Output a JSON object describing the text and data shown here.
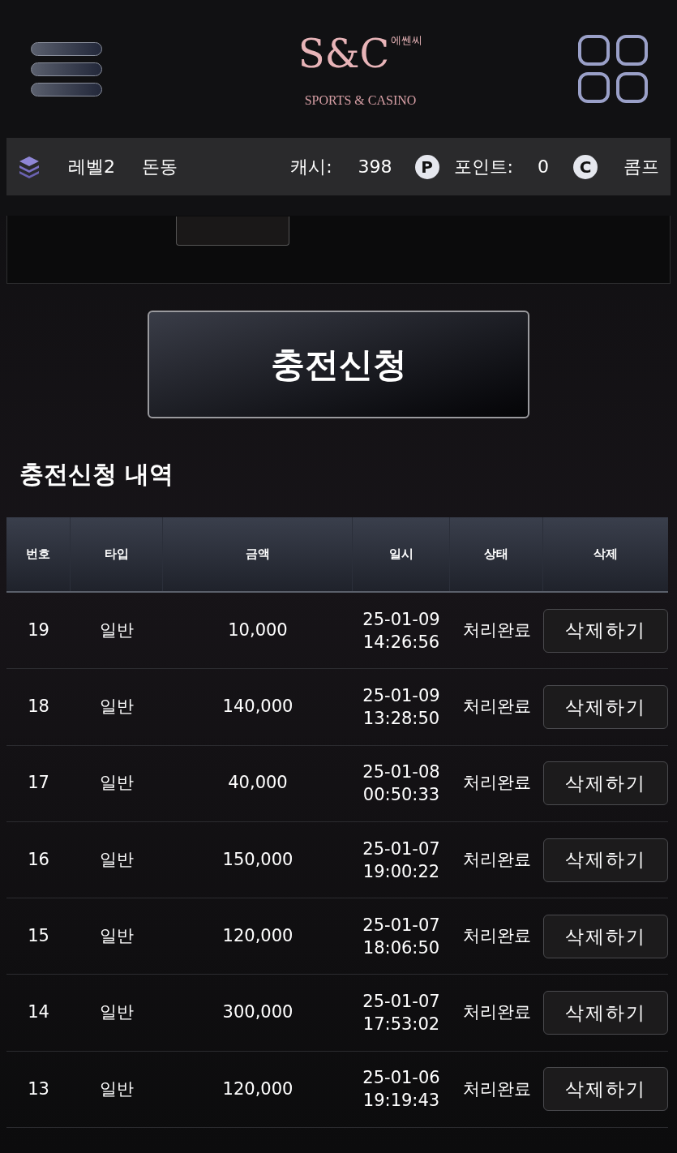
{
  "header": {
    "logo": {
      "mark": "S&C",
      "korean": "에쎈씨",
      "tagline": "SPORTS & CASINO"
    }
  },
  "user_bar": {
    "level": "레벨2",
    "name": "돈동",
    "cash_label": "캐시:",
    "cash": "398",
    "point_icon": "P",
    "point_label": "포인트:",
    "point": "0",
    "comp_icon": "C",
    "comp_label": "콤프"
  },
  "submit_button": "충전신청",
  "history": {
    "title": "충전신청 내역",
    "columns": [
      "번호",
      "타입",
      "금액",
      "일시",
      "상태",
      "삭제"
    ],
    "rows": [
      {
        "no": "19",
        "type": "일반",
        "amount": "10,000",
        "date": "25-01-09",
        "time": "14:26:56",
        "status": "처리완료",
        "action": "삭제하기"
      },
      {
        "no": "18",
        "type": "일반",
        "amount": "140,000",
        "date": "25-01-09",
        "time": "13:28:50",
        "status": "처리완료",
        "action": "삭제하기"
      },
      {
        "no": "17",
        "type": "일반",
        "amount": "40,000",
        "date": "25-01-08",
        "time": "00:50:33",
        "status": "처리완료",
        "action": "삭제하기"
      },
      {
        "no": "16",
        "type": "일반",
        "amount": "150,000",
        "date": "25-01-07",
        "time": "19:00:22",
        "status": "처리완료",
        "action": "삭제하기"
      },
      {
        "no": "15",
        "type": "일반",
        "amount": "120,000",
        "date": "25-01-07",
        "time": "18:06:50",
        "status": "처리완료",
        "action": "삭제하기"
      },
      {
        "no": "14",
        "type": "일반",
        "amount": "300,000",
        "date": "25-01-07",
        "time": "17:53:02",
        "status": "처리완료",
        "action": "삭제하기"
      },
      {
        "no": "13",
        "type": "일반",
        "amount": "120,000",
        "date": "25-01-06",
        "time": "19:19:43",
        "status": "처리완료",
        "action": "삭제하기"
      }
    ]
  }
}
